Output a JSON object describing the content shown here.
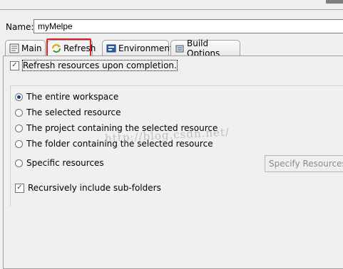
{
  "name_label": "Name:",
  "name_value": "myMelpe",
  "tabs": [
    {
      "label": "Main",
      "icon": "main-tab-icon"
    },
    {
      "label": "Refresh",
      "icon": "refresh-tab-icon"
    },
    {
      "label": "Environment",
      "icon": "environment-tab-icon"
    },
    {
      "label": "Build Options",
      "icon": "build-options-tab-icon"
    }
  ],
  "refresh_on_completion_label": "Refresh resources upon completion.",
  "radio_options": [
    "The entire workspace",
    "The selected resource",
    "The project containing the selected resource",
    "The folder containing the selected resource",
    "Specific resources"
  ],
  "specify_resources_label": "Specify Resources",
  "recursive_label": "Recursively include sub-folders",
  "watermark": "http://blog.csdn.net/",
  "colors": {
    "highlight_box": "#e02020",
    "accent": "#1a3c8a"
  }
}
